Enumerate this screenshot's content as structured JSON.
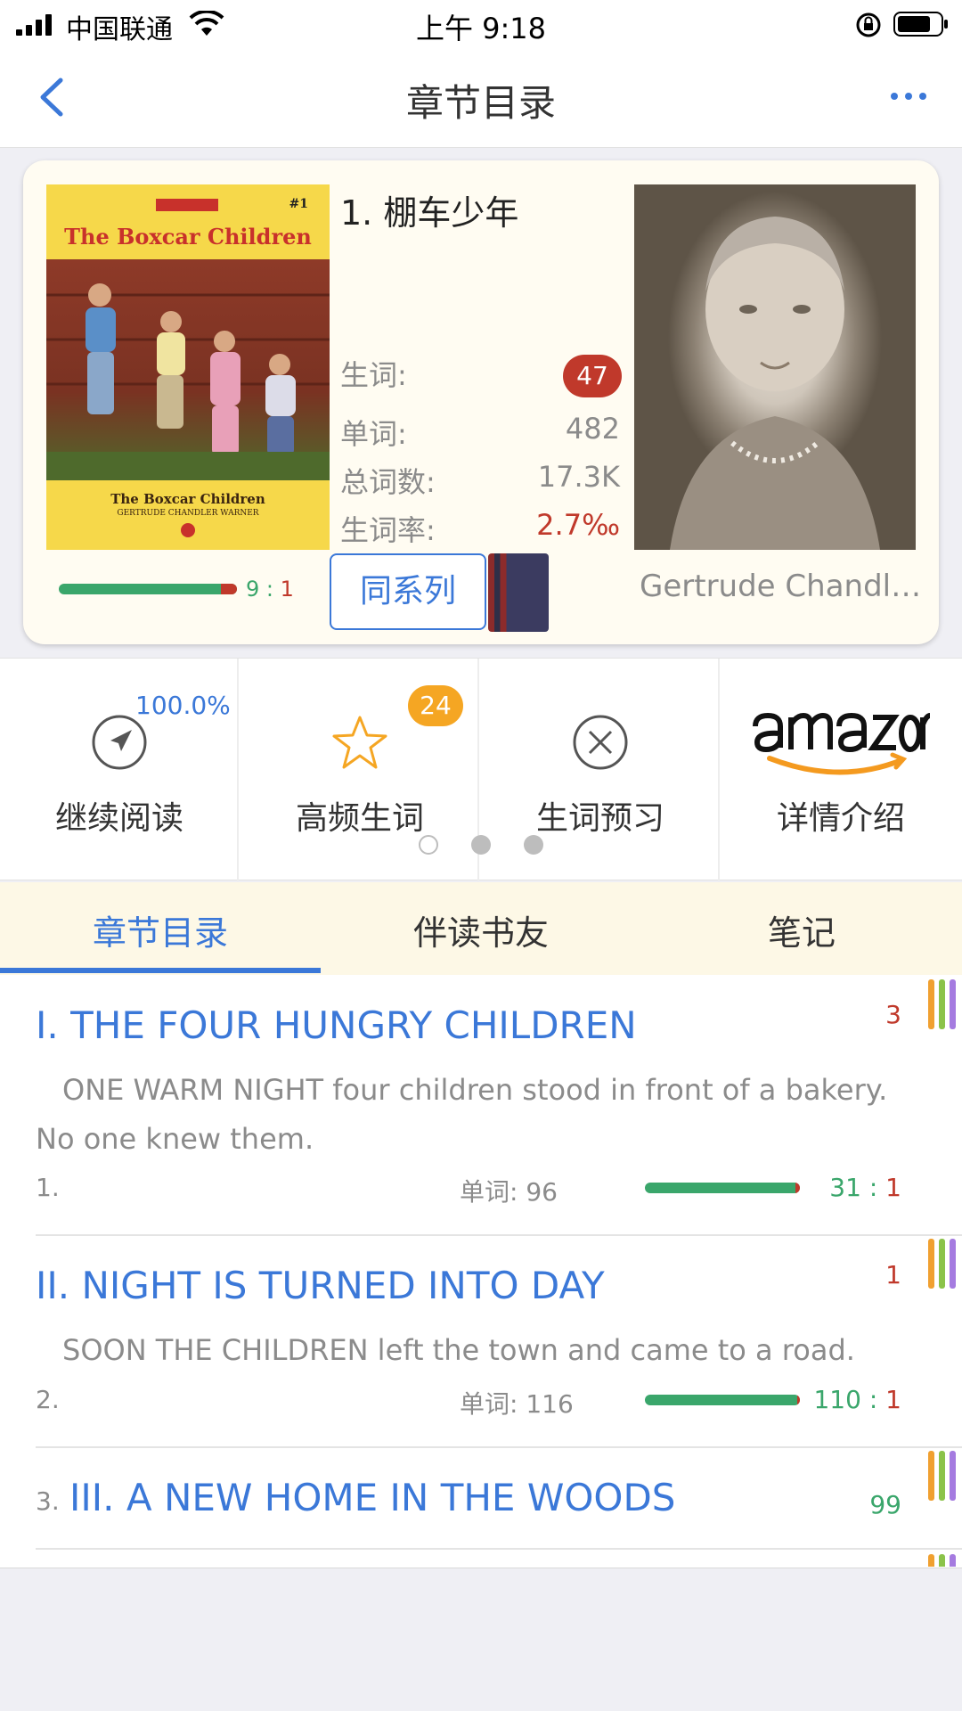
{
  "status_bar": {
    "carrier": "中国联通",
    "time": "上午 9:18"
  },
  "nav": {
    "title": "章节目录"
  },
  "book": {
    "cover_title": "The Boxcar Children",
    "cover_number": "#1",
    "cover_subtitle": "The Boxcar Children",
    "cover_author": "GERTRUDE CHANDLER WARNER",
    "title": "1. 棚车少年",
    "stats": {
      "new_words_label": "生词:",
      "new_words_value": "47",
      "words_label": "单词:",
      "words_value": "482",
      "total_label": "总词数:",
      "total_value": "17.3K",
      "rate_label": "生词率:",
      "rate_value": "2.7‰"
    },
    "progress_fraction": 0.9,
    "ratio_known": "9",
    "ratio_sep": " : ",
    "ratio_unknown": "1",
    "series_label": "同系列",
    "author_name": "Gertrude Chandl…"
  },
  "actions": [
    {
      "label": "继续阅读",
      "icon": "compass-icon",
      "extra": "100.0%"
    },
    {
      "label": "高频生词",
      "icon": "star-icon",
      "badge": "24"
    },
    {
      "label": "生词预习",
      "icon": "close-circle-icon"
    },
    {
      "label": "详情介绍",
      "icon": "amazon-logo"
    }
  ],
  "pager": {
    "count": 3,
    "active": 0
  },
  "tabs": [
    {
      "label": "章节目录",
      "active": true
    },
    {
      "label": "伴读书友",
      "active": false
    },
    {
      "label": "笔记",
      "active": false
    }
  ],
  "chapters": [
    {
      "title": "I. THE FOUR HUNGRY CHILDREN",
      "excerpt": "ONE WARM NIGHT four children stood in front of a bakery. No one knew them.",
      "index": "1.",
      "words": "单词: 96",
      "ratio_known": "31",
      "ratio_sep": " : ",
      "ratio_unknown": "1",
      "count": "3",
      "progress_fraction": 0.97
    },
    {
      "title": "II. NIGHT IS TURNED INTO DAY",
      "excerpt": "SOON THE CHILDREN left the town and came to a road.",
      "index": "2.",
      "words": "单词: 116",
      "ratio_known": "110",
      "ratio_sep": " : ",
      "ratio_unknown": "1",
      "count": "1",
      "progress_fraction": 0.99
    },
    {
      "title": "III. A NEW HOME IN THE WOODS",
      "index": "3.",
      "count": "99"
    }
  ],
  "colors": {
    "accent_blue": "#3b78d8",
    "known_green": "#3aa66b",
    "unknown_red": "#c0392b",
    "badge_orange": "#f5a623",
    "tab_bg": "#fdf8e6",
    "stripe_orange": "#f0a030",
    "stripe_green": "#8bc34a",
    "stripe_purple": "#a57be0"
  }
}
